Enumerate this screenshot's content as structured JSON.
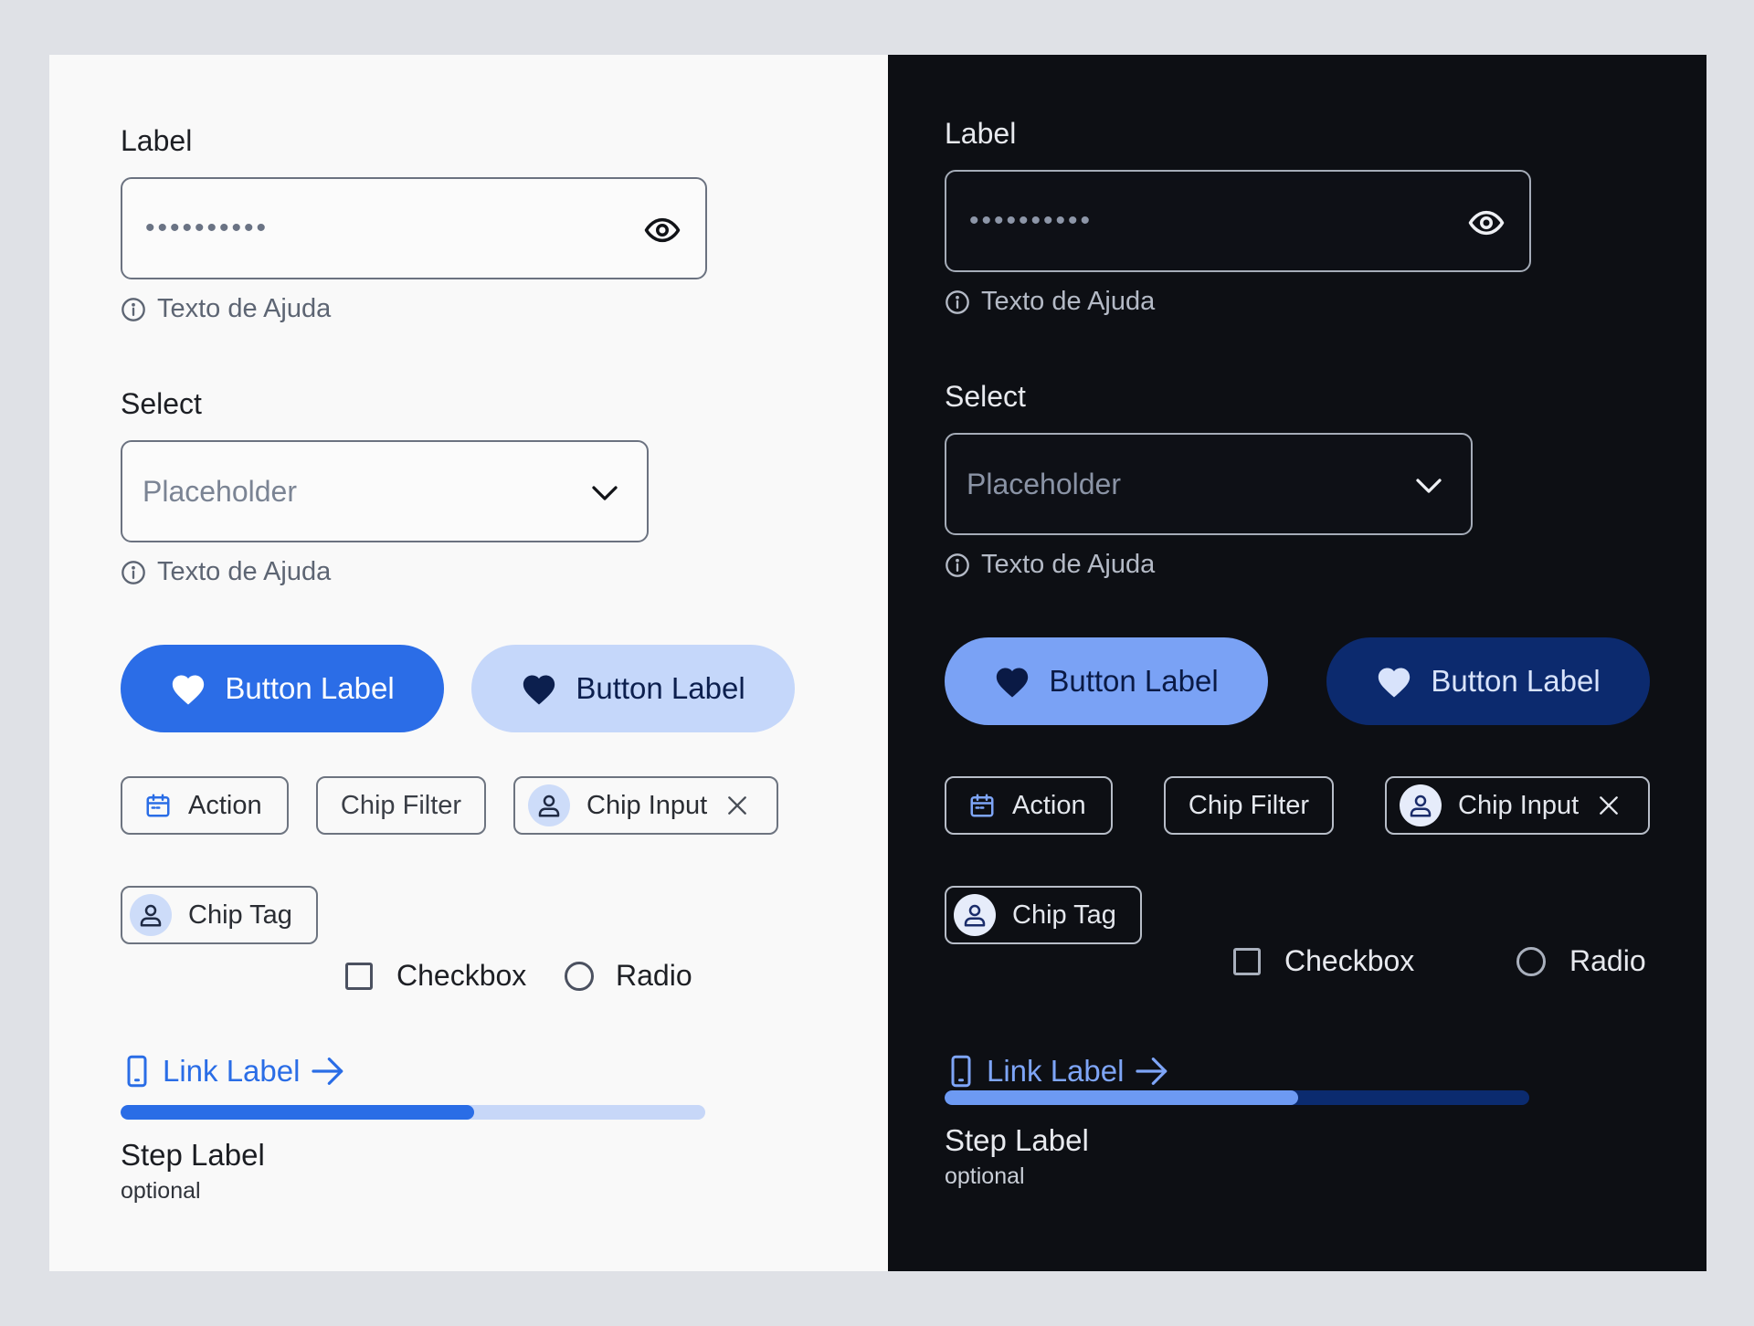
{
  "light": {
    "password_field": {
      "label": "Label",
      "value": "••••••••••",
      "help": "Texto de Ajuda",
      "toggle_icon": "eye-icon"
    },
    "select_field": {
      "label": "Select",
      "placeholder": "Placeholder",
      "help": "Texto de Ajuda",
      "dropdown_icon": "chevron-down-icon"
    },
    "buttons": [
      {
        "label": "Button Label",
        "icon": "heart-icon",
        "bg": "#2b6de7",
        "fg": "#ffffff",
        "icon_color": "#ffffff"
      },
      {
        "label": "Button Label",
        "icon": "heart-icon",
        "bg": "#c5d7fa",
        "fg": "#0c1f4e",
        "icon_color": "#0c1f4e"
      }
    ],
    "chips": {
      "action": "Action",
      "filter": "Chip Filter",
      "input": "Chip Input",
      "tag": "Chip Tag"
    },
    "checkbox_label": "Checkbox",
    "radio_label": "Radio",
    "link_label": "Link Label",
    "progress": {
      "fraction": 0.605
    },
    "step": {
      "label": "Step Label",
      "optional": "optional"
    }
  },
  "dark": {
    "password_field": {
      "label": "Label",
      "value": "••••••••••",
      "help": "Texto de Ajuda",
      "toggle_icon": "eye-icon"
    },
    "select_field": {
      "label": "Select",
      "placeholder": "Placeholder",
      "help": "Texto de Ajuda",
      "dropdown_icon": "chevron-down-icon"
    },
    "buttons": [
      {
        "label": "Button Label",
        "icon": "heart-icon",
        "bg": "#7aa2f5",
        "fg": "#0a1a45",
        "icon_color": "#0a1a45"
      },
      {
        "label": "Button Label",
        "icon": "heart-icon",
        "bg": "#0c2a6e",
        "fg": "#d8e3fb",
        "icon_color": "#d8e3fb"
      }
    ],
    "chips": {
      "action": "Action",
      "filter": "Chip Filter",
      "input": "Chip Input",
      "tag": "Chip Tag"
    },
    "checkbox_label": "Checkbox",
    "radio_label": "Radio",
    "link_label": "Link Label",
    "progress": {
      "fraction": 0.605
    },
    "step": {
      "label": "Step Label",
      "optional": "optional"
    }
  }
}
